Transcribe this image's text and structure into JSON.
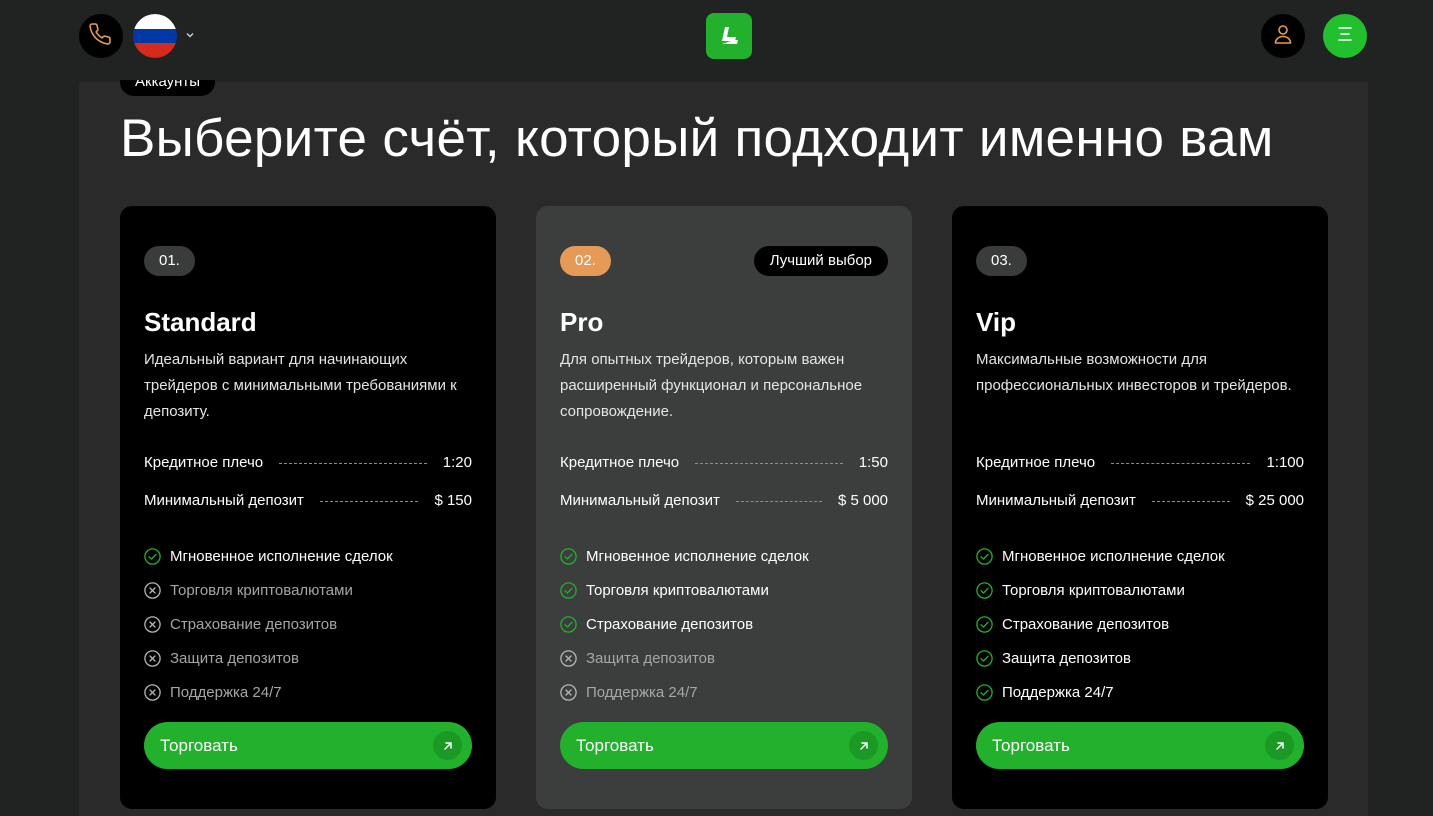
{
  "header": {
    "phone_icon": "phone-icon",
    "language": "ru",
    "flag_colors": [
      "#ffffff",
      "#0039a6",
      "#d52b1e"
    ],
    "logo_icon": "logo-icon",
    "user_icon": "user-icon",
    "menu_icon": "menu-icon"
  },
  "section": {
    "tag": "Аккаунты",
    "title": "Выберите счёт, который подходит именно вам"
  },
  "colors": {
    "accent_green": "#22b02d",
    "badge_orange": "#e59a58",
    "check_green": "#22b02d"
  },
  "cards": [
    {
      "number": "01.",
      "name": "Standard",
      "description": "Идеальный вариант для начинающих трейдеров с минимальными требованиями к депозиту.",
      "leverage_label": "Кредитное плечо",
      "leverage_value": "1:20",
      "deposit_label": "Минимальный депозит",
      "deposit_value": "$ 150",
      "features": [
        {
          "label": "Мгновенное исполнение сделок",
          "included": true
        },
        {
          "label": "Торговля криптовалютами",
          "included": false
        },
        {
          "label": "Страхование депозитов",
          "included": false
        },
        {
          "label": "Защита депозитов",
          "included": false
        },
        {
          "label": "Поддержка 24/7",
          "included": false
        }
      ],
      "button": "Торговать"
    },
    {
      "number": "02.",
      "badge": "Лучший выбор",
      "name": "Pro",
      "description": "Для опытных трейдеров, которым важен расширенный функционал и персональное сопровождение.",
      "leverage_label": "Кредитное плечо",
      "leverage_value": "1:50",
      "deposit_label": "Минимальный депозит",
      "deposit_value": "$ 5 000",
      "features": [
        {
          "label": "Мгновенное исполнение сделок",
          "included": true
        },
        {
          "label": "Торговля криптовалютами",
          "included": true
        },
        {
          "label": "Страхование депозитов",
          "included": true
        },
        {
          "label": "Защита депозитов",
          "included": false
        },
        {
          "label": "Поддержка 24/7",
          "included": false
        }
      ],
      "button": "Торговать"
    },
    {
      "number": "03.",
      "name": "Vip",
      "description": "Максимальные возможности для профессиональных инвесторов и трейдеров.",
      "leverage_label": "Кредитное плечо",
      "leverage_value": "1:100",
      "deposit_label": "Минимальный депозит",
      "deposit_value": "$ 25 000",
      "features": [
        {
          "label": "Мгновенное исполнение сделок",
          "included": true
        },
        {
          "label": "Торговля криптовалютами",
          "included": true
        },
        {
          "label": "Страхование депозитов",
          "included": true
        },
        {
          "label": "Защита депозитов",
          "included": true
        },
        {
          "label": "Поддержка 24/7",
          "included": true
        }
      ],
      "button": "Торговать"
    }
  ]
}
